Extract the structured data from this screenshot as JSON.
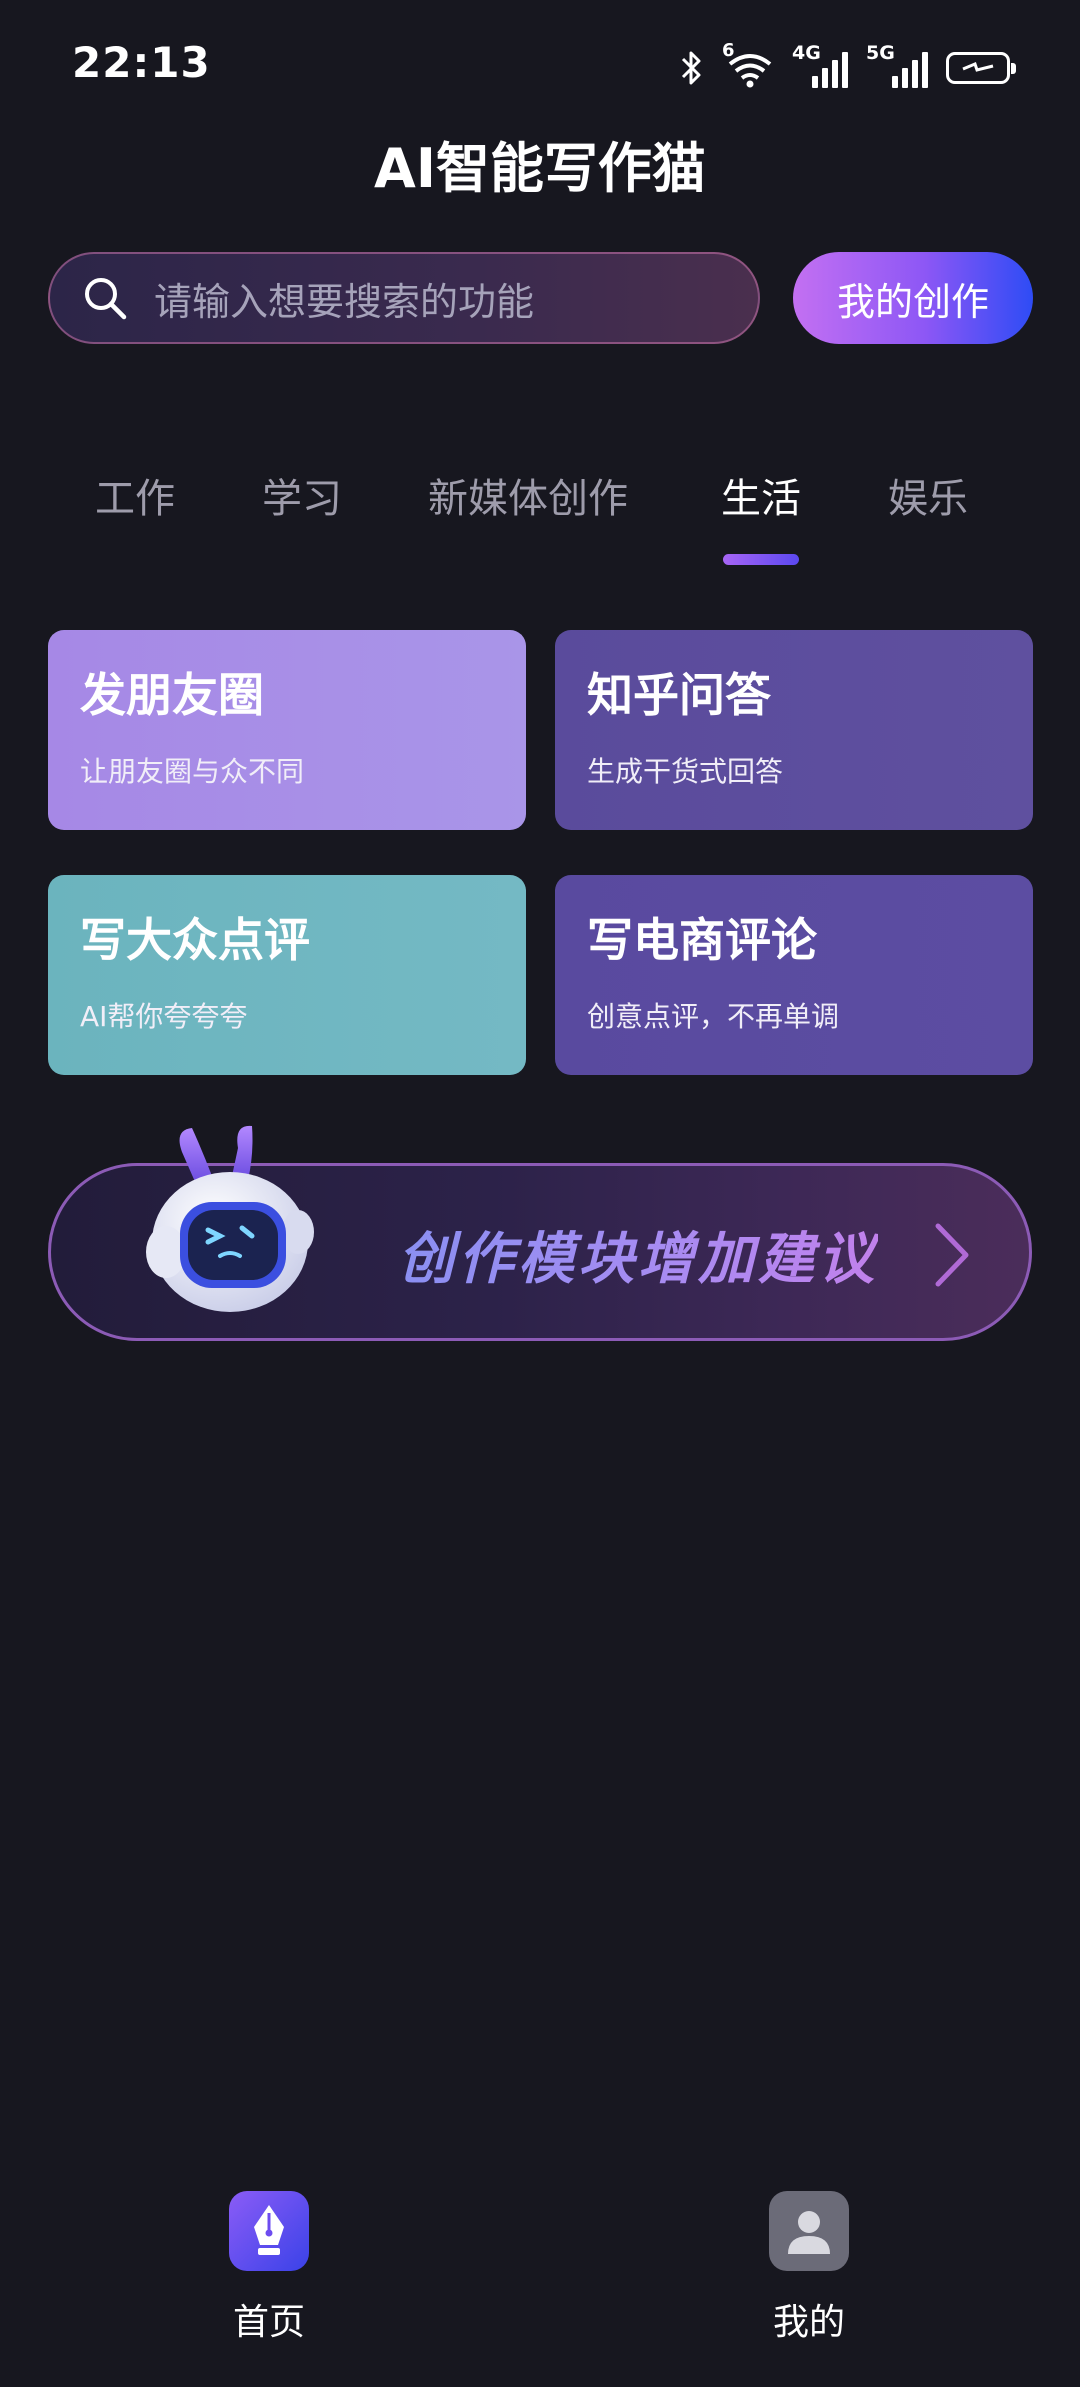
{
  "status_bar": {
    "time": "22:13",
    "wifi_badge": "6",
    "network_1": "4G",
    "network_2": "5G"
  },
  "header": {
    "title": "AI智能写作猫"
  },
  "search": {
    "placeholder": "请输入想要搜索的功能",
    "my_creation_label": "我的创作"
  },
  "tabs": [
    {
      "label": "工作",
      "active": false
    },
    {
      "label": "学习",
      "active": false
    },
    {
      "label": "新媒体创作",
      "active": false
    },
    {
      "label": "生活",
      "active": true
    },
    {
      "label": "娱乐",
      "active": false
    }
  ],
  "cards": [
    {
      "title": "发朋友圈",
      "subtitle": "让朋友圈与众不同",
      "color": "#a78ee7"
    },
    {
      "title": "知乎问答",
      "subtitle": "生成干货式回答",
      "color": "#5c4d9e"
    },
    {
      "title": "写大众点评",
      "subtitle": "AI帮你夸夸夸",
      "color": "#70b7c1"
    },
    {
      "title": "写电商评论",
      "subtitle": "创意点评，不再单调",
      "color": "#5a4ba0"
    }
  ],
  "suggestion_banner": {
    "label": "创作模块增加建议"
  },
  "bottom_nav": [
    {
      "label": "首页",
      "icon": "pen-nib-icon",
      "active": true
    },
    {
      "label": "我的",
      "icon": "user-icon",
      "active": false
    }
  ],
  "colors": {
    "background": "#17171f",
    "accent_purple": "#8d57f5",
    "accent_blue": "#2e4cf5"
  }
}
